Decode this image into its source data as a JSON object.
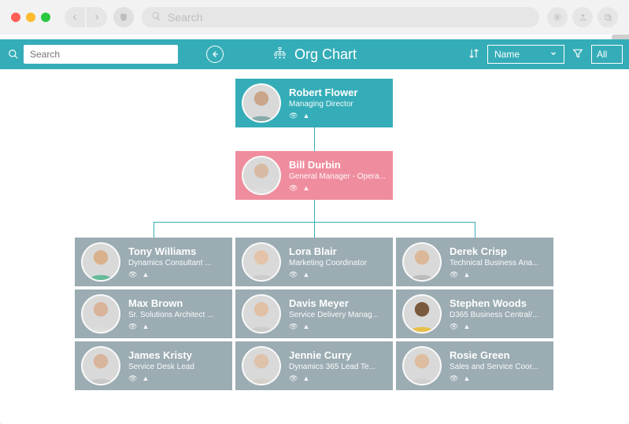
{
  "chrome": {
    "search_placeholder": "Search"
  },
  "toolbar": {
    "search_placeholder": "Search",
    "title": "Org Chart",
    "sort_label": "Name",
    "filter_label": "All"
  },
  "nodes": {
    "root": {
      "name": "Robert Flower",
      "title": "Managing Director"
    },
    "lvl1": {
      "name": "Bill Durbin",
      "title": "General Manager - Opera..."
    },
    "grid": [
      {
        "name": "Tony Williams",
        "title": "Dynamics Consultant ..."
      },
      {
        "name": "Lora Blair",
        "title": "Marketing Coordinator"
      },
      {
        "name": "Derek Crisp",
        "title": "Technical Business Ana..."
      },
      {
        "name": "Max Brown",
        "title": "Sr. Solutions Architect ..."
      },
      {
        "name": "Davis Meyer",
        "title": "Service Delivery Manag..."
      },
      {
        "name": "Stephen Woods",
        "title": "D365 Business Central/..."
      },
      {
        "name": "James Kristy",
        "title": "Service Desk Lead"
      },
      {
        "name": "Jennie Curry",
        "title": "Dynamics 365 Lead Te..."
      },
      {
        "name": "Rosie Green",
        "title": "Sales and Service Coor..."
      }
    ]
  }
}
